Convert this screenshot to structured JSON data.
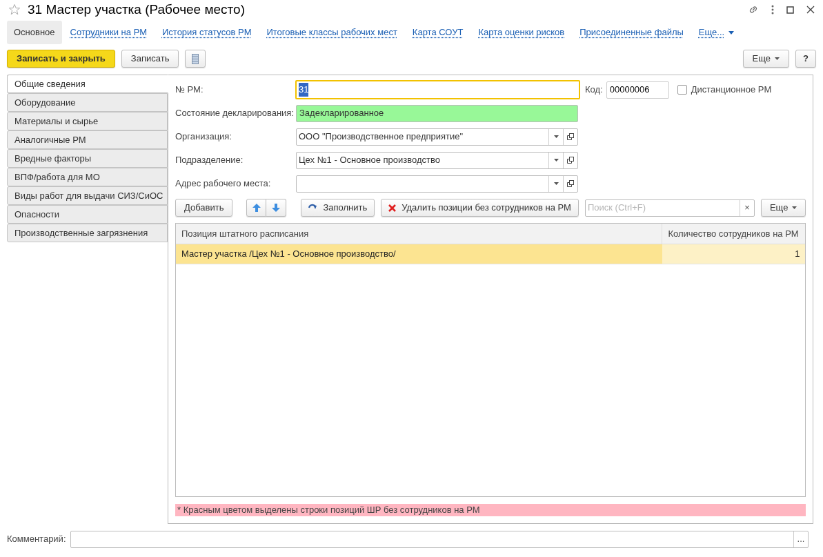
{
  "window": {
    "title": "31 Мастер участка (Рабочее место)",
    "favorite": false
  },
  "nav_tabs": [
    {
      "label": "Основное",
      "selected": true,
      "kind": "tab"
    },
    {
      "label": "Сотрудники на РМ",
      "selected": false,
      "kind": "tab"
    },
    {
      "label": "История статусов РМ",
      "selected": false,
      "kind": "tab"
    },
    {
      "label": "Итоговые классы рабочих мест",
      "selected": false,
      "kind": "tab"
    },
    {
      "label": "Карта СОУТ",
      "selected": false,
      "kind": "tab"
    },
    {
      "label": "Карта оценки рисков",
      "selected": false,
      "kind": "tab"
    },
    {
      "label": "Присоединенные файлы",
      "selected": false,
      "kind": "tab"
    },
    {
      "label": "Еще...",
      "selected": false,
      "kind": "more"
    }
  ],
  "toolbar": {
    "save_close": "Записать и закрыть",
    "save": "Записать",
    "more": "Еще",
    "help": "?"
  },
  "side_tabs": [
    {
      "label": "Общие сведения",
      "selected": true
    },
    {
      "label": "Оборудование",
      "selected": false
    },
    {
      "label": "Материалы и сырье",
      "selected": false
    },
    {
      "label": "Аналогичные РМ",
      "selected": false
    },
    {
      "label": "Вредные факторы",
      "selected": false
    },
    {
      "label": "ВПФ/работа для МО",
      "selected": false
    },
    {
      "label": "Виды работ для выдачи СИЗ/СиОС",
      "selected": false
    },
    {
      "label": "Опасности",
      "selected": false
    },
    {
      "label": "Производственные загрязнения",
      "selected": false
    }
  ],
  "fields": [
    {
      "label": "№ РМ:",
      "value": "31",
      "kind": "text",
      "focused": true
    },
    {
      "label": "Состояние декларирования:",
      "value": "Задекларированное",
      "kind": "status",
      "focused": false
    },
    {
      "label": "Организация:",
      "value": "ООО \"Производственное предприятие\"",
      "kind": "select",
      "focused": false
    },
    {
      "label": "Подразделение:",
      "value": "Цех №1 - Основное производство",
      "kind": "select",
      "focused": false
    },
    {
      "label": "Адрес рабочего места:",
      "kind": "select",
      "focused": false
    }
  ],
  "code": {
    "label": "Код:",
    "value": "00000006"
  },
  "remote": {
    "label": "Дистанционное РМ",
    "checked": false
  },
  "table_toolbar": {
    "add": "Добавить",
    "fill": "Заполнить",
    "delete": "Удалить позиции без сотрудников на РМ",
    "search_placeholder": "Поиск (Ctrl+F)",
    "clear": "×",
    "more": "Еще"
  },
  "table": {
    "columns": [
      "Позиция штатного расписания",
      "Количество сотрудников на РМ"
    ],
    "rows": [
      {
        "cells": [
          "Мастер участка /Цех №1 - Основное производство/",
          "1"
        ],
        "selected": true
      }
    ]
  },
  "note": "* Красным цветом выделены строки позиций ШР без сотрудников на РМ",
  "comment": {
    "label": "Комментарий:",
    "button": "..."
  }
}
